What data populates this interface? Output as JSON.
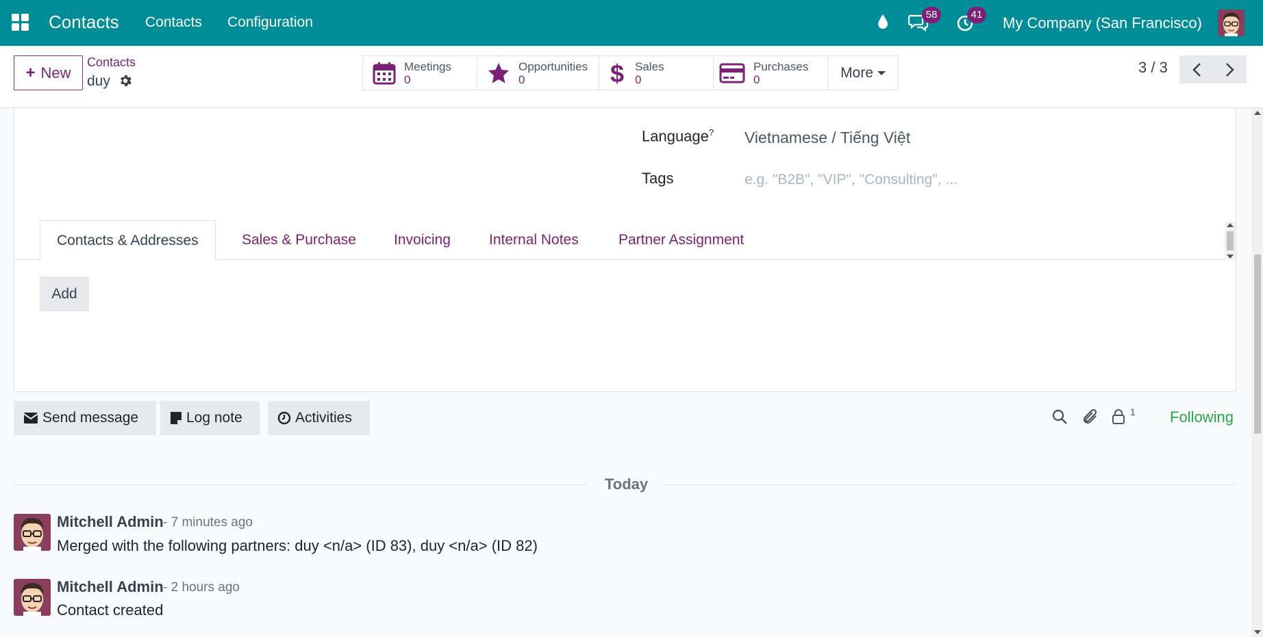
{
  "navbar": {
    "app_name": "Contacts",
    "menu": [
      "Contacts",
      "Configuration"
    ],
    "chat_badge": "58",
    "activity_badge": "41",
    "company": "My Company (San Francisco)",
    "bg_color": "#018d98"
  },
  "control": {
    "new_label": "New",
    "breadcrumb_parent": "Contacts",
    "breadcrumb_current": "duy",
    "smart_buttons": [
      {
        "label": "Meetings",
        "value": "0",
        "icon": "calendar-icon"
      },
      {
        "label": "Opportunities",
        "value": "0",
        "icon": "star-icon"
      },
      {
        "label": "Sales",
        "value": "0",
        "icon": "dollar-icon"
      },
      {
        "label": "Purchases",
        "value": "0",
        "icon": "credit-card-icon"
      }
    ],
    "more_label": "More",
    "pager": "3 / 3"
  },
  "form": {
    "language_label": "Language",
    "language_help": "?",
    "language_value": "Vietnamese / Tiếng Việt",
    "tags_label": "Tags",
    "tags_placeholder": "e.g. \"B2B\", \"VIP\", \"Consulting\", ...",
    "tabs": [
      "Contacts & Addresses",
      "Sales & Purchase",
      "Invoicing",
      "Internal Notes",
      "Partner Assignment"
    ],
    "active_tab": "Contacts & Addresses",
    "add_label": "Add"
  },
  "chatter": {
    "send_message": "Send message",
    "log_note": "Log note",
    "activities": "Activities",
    "followers_count": "1",
    "following_label": "Following",
    "date_separator": "Today",
    "messages": [
      {
        "author": "Mitchell Admin",
        "time": "- 7 minutes ago",
        "body": "Merged with the following partners: duy <n/a> (ID 83), duy <n/a> (ID 82)"
      },
      {
        "author": "Mitchell Admin",
        "time": "- 2 hours ago",
        "body": "Contact created"
      }
    ]
  },
  "colors": {
    "primary": "#7c1f76",
    "teal": "#018d98",
    "success": "#28a745"
  }
}
